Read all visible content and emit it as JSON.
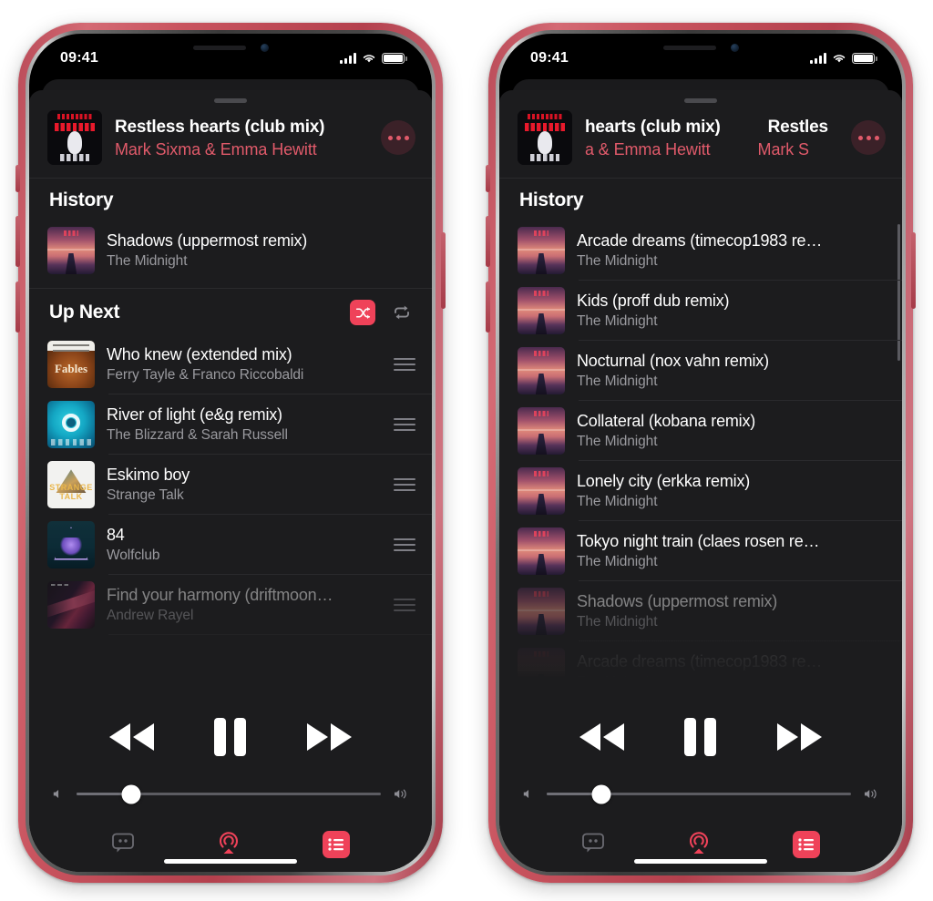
{
  "status_bar": {
    "time": "09:41",
    "icons": [
      "cellular-signal",
      "wifi",
      "battery"
    ]
  },
  "now_playing": {
    "title": "Restless hearts (club mix)",
    "artist": "Mark Sixma & Emma Hewitt",
    "artwork": "restless-hearts-album-art",
    "more_label": "•••",
    "right_phone_title_fragment": "hearts (club mix)",
    "right_phone_artist_fragment": "a & Emma Hewitt",
    "right_phone_title_repeat": "Restles",
    "right_phone_artist_repeat": "Mark S"
  },
  "sections": {
    "history_label": "History",
    "up_next_label": "Up Next"
  },
  "left_phone": {
    "history": [
      {
        "title": "Shadows (uppermost remix)",
        "artist": "The Midnight",
        "art": "midnight"
      }
    ],
    "up_next": [
      {
        "title": "Who knew (extended mix)",
        "artist": "Ferry Tayle & Franco Riccobaldi",
        "art": "fables"
      },
      {
        "title": "River of light (e&g remix)",
        "artist": "The Blizzard & Sarah Russell",
        "art": "river"
      },
      {
        "title": "Eskimo boy",
        "artist": "Strange Talk",
        "art": "strange"
      },
      {
        "title": "84",
        "artist": "Wolfclub",
        "art": "wolf"
      },
      {
        "title": "Find your harmony (driftmoon…",
        "artist": "Andrew Rayel",
        "art": "rayel"
      }
    ],
    "shuffle_state": "on",
    "repeat_state": "off"
  },
  "right_phone": {
    "history": [
      {
        "title": "Arcade dreams (timecop1983 re…",
        "artist": "The Midnight",
        "art": "midnight"
      },
      {
        "title": "Kids (proff dub remix)",
        "artist": "The Midnight",
        "art": "midnight"
      },
      {
        "title": "Nocturnal (nox vahn remix)",
        "artist": "The Midnight",
        "art": "midnight"
      },
      {
        "title": "Collateral (kobana remix)",
        "artist": "The Midnight",
        "art": "midnight"
      },
      {
        "title": "Lonely city (erkka remix)",
        "artist": "The Midnight",
        "art": "midnight"
      },
      {
        "title": "Tokyo night train (claes rosen re…",
        "artist": "The Midnight",
        "art": "midnight"
      },
      {
        "title": "Shadows (uppermost remix)",
        "artist": "The Midnight",
        "art": "midnight"
      }
    ]
  },
  "transport": {
    "rewind_label": "rewind",
    "pause_label": "pause",
    "forward_label": "fast-forward",
    "state": "playing"
  },
  "volume": {
    "level_percent": 18,
    "min_icon": "speaker-low-icon",
    "max_icon": "speaker-high-icon"
  },
  "bottom_bar": {
    "lyrics_label": "lyrics",
    "airplay_label": "airplay",
    "queue_label": "queue",
    "active_tab": "queue"
  },
  "colors": {
    "accent": "#ef4259",
    "accent_soft": "#e05a6a",
    "sheet_bg": "#1c1c1e",
    "screen_bg": "#000000",
    "separator": "#2a2a2d",
    "secondary_text": "#9a9a9f",
    "device_body": "#c9545f"
  }
}
